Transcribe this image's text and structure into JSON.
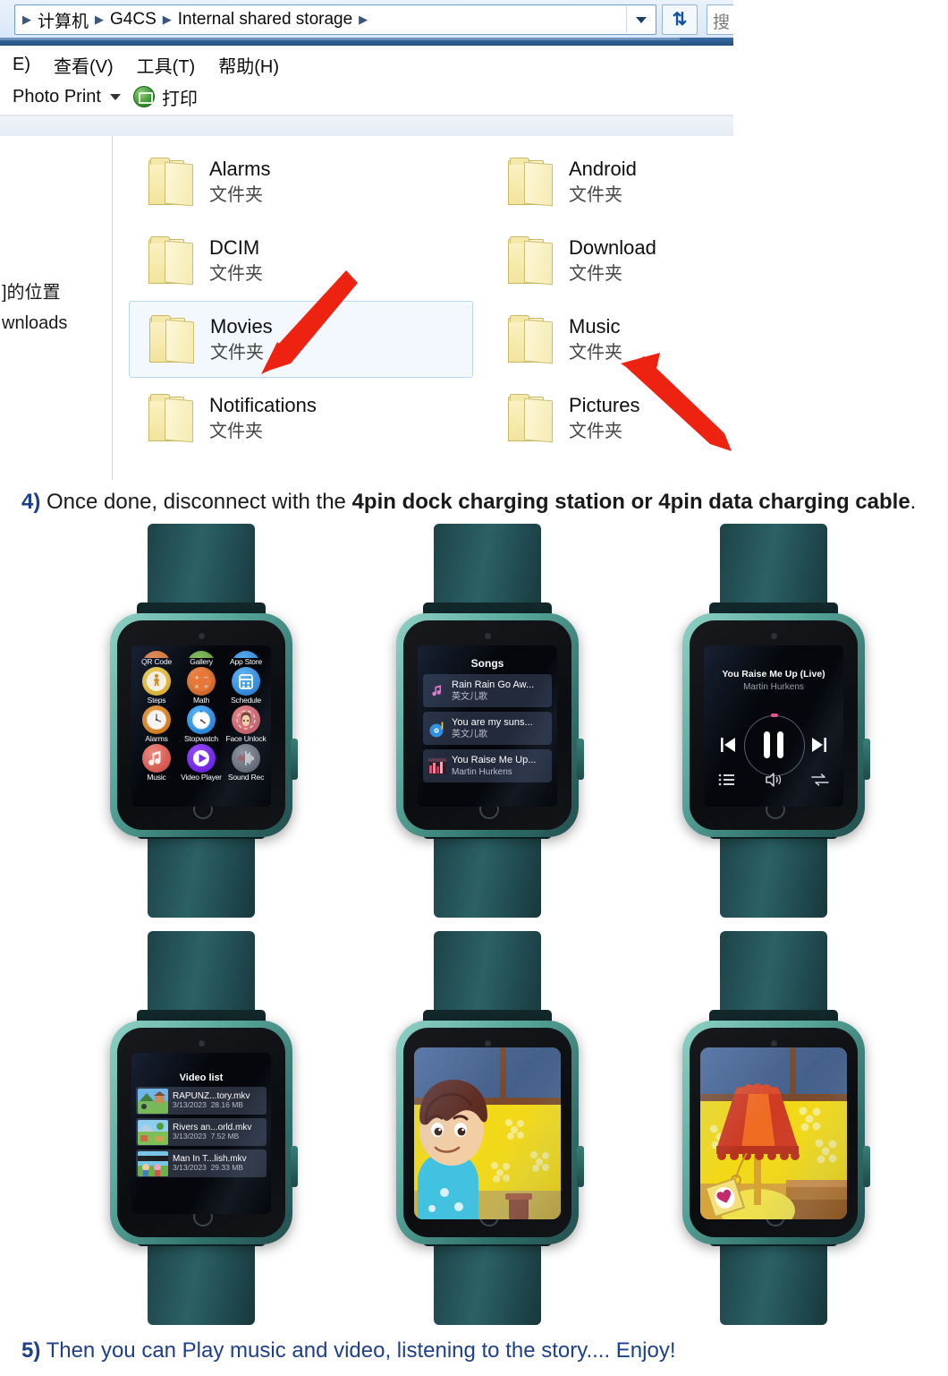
{
  "explorer": {
    "address": {
      "crumbs": [
        "计算机",
        "G4CS",
        "Internal shared storage"
      ],
      "dropdown_icon": "chevron-down-icon",
      "refresh_icon": "refresh-icon",
      "search_text": "搜"
    },
    "menu": [
      "E)",
      "查看(V)",
      "工具(T)",
      "帮助(H)"
    ],
    "toolbar": {
      "photo_print": "Photo Print",
      "caret_icon": "chevron-down-icon",
      "print_icon": "print-icon",
      "print_label": "打印"
    },
    "nav_pane": [
      "]的位置",
      "wnloads"
    ],
    "files": [
      {
        "name": "Alarms",
        "type": "文件夹",
        "selected": false
      },
      {
        "name": "Android",
        "type": "文件夹",
        "selected": false
      },
      {
        "name": "DCIM",
        "type": "文件夹",
        "selected": false
      },
      {
        "name": "Download",
        "type": "文件夹",
        "selected": false
      },
      {
        "name": "Movies",
        "type": "文件夹",
        "selected": true
      },
      {
        "name": "Music",
        "type": "文件夹",
        "selected": false
      },
      {
        "name": "Notifications",
        "type": "文件夹",
        "selected": false
      },
      {
        "name": "Pictures",
        "type": "文件夹",
        "selected": false
      }
    ],
    "annotations": [
      {
        "name": "arrow-to-movies",
        "color": "#ee2211"
      },
      {
        "name": "arrow-to-music",
        "color": "#ee2211"
      }
    ]
  },
  "captions": {
    "step4": {
      "num": "4)",
      "text_before": " Once done, disconnect with the ",
      "bold": "4pin dock charging station or 4pin data charging cable",
      "text_after": "."
    },
    "step5": {
      "num": "5)",
      "text": " Then you can Play music and video, listening to the story.... Enjoy!"
    }
  },
  "watches": {
    "app_grid": {
      "label": "watch-app-grid",
      "rows": [
        [
          {
            "name": "QR Code",
            "icon": "qr-code-icon",
            "color": "#d9652a"
          },
          {
            "name": "Gallery",
            "icon": "gallery-icon",
            "color": "#6fae4a"
          },
          {
            "name": "App Store",
            "icon": "app-store-icon",
            "color": "#2f86d6"
          }
        ],
        [
          {
            "name": "Steps",
            "icon": "steps-icon",
            "color": "#e8b93c"
          },
          {
            "name": "Math",
            "icon": "math-icon",
            "color": "#d9652a"
          },
          {
            "name": "Schedule",
            "icon": "calendar-icon",
            "color": "#2f86d6"
          }
        ],
        [
          {
            "name": "Alarms",
            "icon": "alarm-clock-icon",
            "color": "#e0811f"
          },
          {
            "name": "Stopwatch",
            "icon": "stopwatch-icon",
            "color": "#2f9cf0"
          },
          {
            "name": "Face Unlock",
            "icon": "face-unlock-icon",
            "color": "#d2636b"
          }
        ],
        [
          {
            "name": "Music",
            "icon": "music-note-icon",
            "color": "#e0584f"
          },
          {
            "name": "Video Player",
            "icon": "play-icon",
            "color": "#7b2ff0"
          },
          {
            "name": "Sound Rec",
            "icon": "waveform-icon",
            "color": "#6b6f76"
          }
        ]
      ]
    },
    "songs": {
      "label": "watch-songs-list",
      "title": "Songs",
      "items": [
        {
          "title": "Rain Rain Go Aw...",
          "artist": "英文儿歌",
          "icon": "music-note-icon"
        },
        {
          "title": "You are my suns...",
          "artist": "英文儿歌",
          "icon": "vinyl-disc-icon"
        },
        {
          "title": "You Raise Me Up...",
          "artist": "Martin Hurkens",
          "icon": "album-art-icon"
        }
      ]
    },
    "player": {
      "label": "watch-music-player",
      "title": "You Raise Me Up (Live)",
      "artist": "Martin Hurkens",
      "prev_icon": "previous-track-icon",
      "pause_icon": "pause-icon",
      "next_icon": "next-track-icon",
      "playlist_icon": "playlist-icon",
      "volume_icon": "volume-icon",
      "repeat_icon": "shuffle-repeat-icon"
    },
    "video_list": {
      "label": "watch-video-list",
      "title": "Video list",
      "items": [
        {
          "name": "RAPUNZ...tory.mkv",
          "date": "3/13/2023",
          "size": "28.16 MB"
        },
        {
          "name": "Rivers an...orld.mkv",
          "date": "3/13/2023",
          "size": "7.52 MB"
        },
        {
          "name": "Man In T...lish.mkv",
          "date": "3/13/2023",
          "size": "29.33 MB"
        }
      ]
    },
    "video_boy": {
      "label": "watch-video-playing-boy"
    },
    "video_lamp": {
      "label": "watch-video-playing-lamp"
    }
  }
}
